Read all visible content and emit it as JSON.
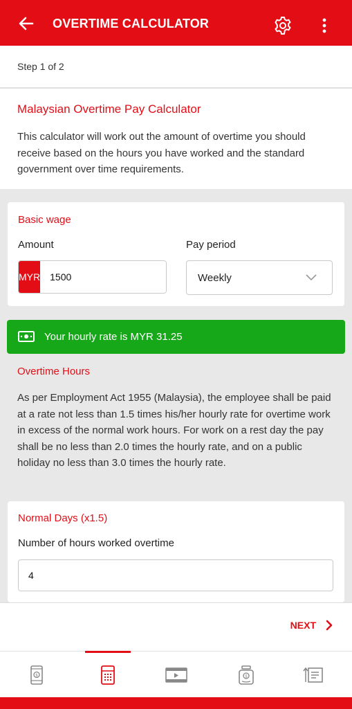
{
  "app_bar": {
    "title": "OVERTIME CALCULATOR",
    "back_icon": "arrow-left-icon",
    "settings_icon": "gear-icon",
    "more_icon": "more-vertical-icon"
  },
  "step": {
    "text": "Step 1 of 2"
  },
  "intro": {
    "title": "Malaysian Overtime Pay Calculator",
    "text": "This calculator will work out the amount of overtime you should receive based on the hours you have worked and the standard government over time requirements."
  },
  "basic_wage": {
    "title": "Basic wage",
    "amount_label": "Amount",
    "currency": "MYR",
    "amount_value": "1500",
    "pay_period_label": "Pay period",
    "pay_period_value": "Weekly"
  },
  "hourly_rate": {
    "icon": "cash-icon",
    "text": "Your hourly rate is MYR 31.25"
  },
  "overtime": {
    "title": "Overtime Hours",
    "text": "As per Employment Act 1955 (Malaysia), the employee shall be paid at a rate not less than 1.5 times his/her hourly rate for overtime work in excess of the normal work hours. For work on a rest day the pay shall be no less than 2.0 times the hourly rate, and on a public holiday no less than 3.0 times the hourly rate."
  },
  "normal_days": {
    "title": "Normal Days (x1.5)",
    "hours_label": "Number of hours worked overtime",
    "hours_value": "4"
  },
  "footer": {
    "next_label": "NEXT"
  },
  "bottom_nav": {
    "items": [
      {
        "icon": "mobile-money-icon",
        "active": false
      },
      {
        "icon": "calculator-icon",
        "active": true
      },
      {
        "icon": "video-icon",
        "active": false
      },
      {
        "icon": "savings-jar-icon",
        "active": false
      },
      {
        "icon": "list-icon",
        "active": false
      }
    ]
  },
  "colors": {
    "brand": "#e30d16",
    "success": "#17a81a"
  }
}
